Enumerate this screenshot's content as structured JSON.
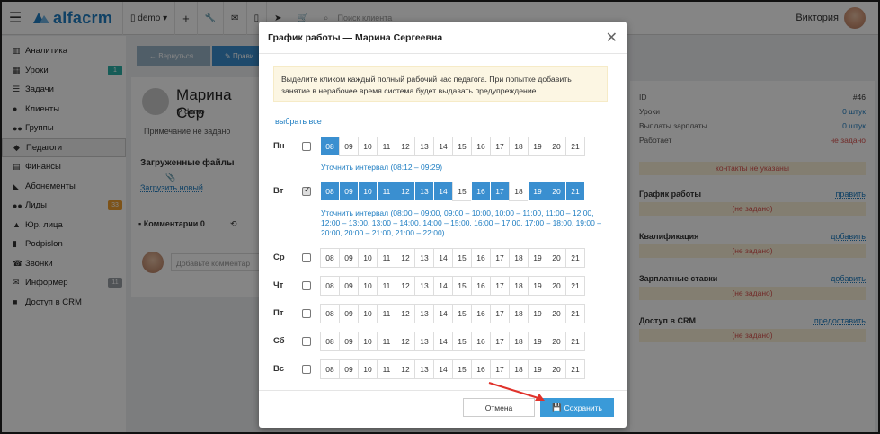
{
  "topbar": {
    "brand": "alfacrm",
    "branch": "demo",
    "search_placeholder": "Поиск клиента",
    "user_name": "Виктория"
  },
  "sidebar": {
    "items": [
      {
        "label": "Аналитика",
        "icon": "chart-icon"
      },
      {
        "label": "Уроки",
        "icon": "calendar-icon",
        "badge": "1"
      },
      {
        "label": "Задачи",
        "icon": "tasks-icon"
      },
      {
        "label": "Клиенты",
        "icon": "user-icon"
      },
      {
        "label": "Группы",
        "icon": "group-icon"
      },
      {
        "label": "Педагоги",
        "icon": "graduation-cap-icon"
      },
      {
        "label": "Финансы",
        "icon": "money-icon"
      },
      {
        "label": "Абонементы",
        "icon": "tag-icon"
      },
      {
        "label": "Лиды",
        "icon": "users-icon",
        "badge": "33"
      },
      {
        "label": "Юр. лица",
        "icon": "bank-icon"
      },
      {
        "label": "Podpislon",
        "icon": "file-icon"
      },
      {
        "label": "Звонки",
        "icon": "phone-icon"
      },
      {
        "label": "Информер",
        "icon": "envelope-icon",
        "badge": "11"
      },
      {
        "label": "Доступ в CRM",
        "icon": "lock-icon"
      }
    ]
  },
  "background": {
    "back_button": "Вернуться",
    "edit_button": "Прави",
    "teacher_name": "Марина Сер",
    "branch": "demo",
    "note": "Примечание не задано",
    "files_title": "Загруженные файлы",
    "upload_link": "Загрузить новый",
    "comments_tab": "Комментарии 0",
    "comment_placeholder": "Добавьте комментар",
    "right_panel": {
      "id_label": "ID",
      "id_value": "#46",
      "lessons_label": "Уроки",
      "lessons_value": "0 штук",
      "salary_label": "Выплаты зарплаты",
      "salary_value": "0 штук",
      "works_label": "Работает",
      "works_value": "не задано",
      "contacts_band": "контакты не указаны",
      "schedule_label": "График работы",
      "schedule_action": "править",
      "schedule_value": "(не задано)",
      "qual_label": "Квалификация",
      "qual_action": "добавить",
      "qual_value": "(не задано)",
      "rates_label": "Зарплатные ставки",
      "rates_action": "добавить",
      "rates_value": "(не задано)",
      "access_label": "Доступ в CRM",
      "access_action": "предоставить",
      "access_value": "(не задано)"
    }
  },
  "modal": {
    "title": "График работы — Марина Сергеевна",
    "notice": "Выделите кликом каждый полный рабочий час педагога. При попытке добавить занятие в нерабочее время система будет выдавать предупреждение.",
    "select_all": "выбрать все",
    "hours": [
      "08",
      "09",
      "10",
      "11",
      "12",
      "13",
      "14",
      "15",
      "16",
      "17",
      "18",
      "19",
      "20",
      "21"
    ],
    "days": [
      {
        "label": "Пн",
        "checked": false,
        "selected": [
          "08"
        ],
        "interval": "Уточнить интервал (08:12 – 09:29)"
      },
      {
        "label": "Вт",
        "checked": true,
        "selected": [
          "08",
          "09",
          "10",
          "11",
          "12",
          "13",
          "14",
          "16",
          "17",
          "19",
          "20",
          "21"
        ],
        "interval": "Уточнить интервал (08:00 – 09:00, 09:00 – 10:00, 10:00 – 11:00, 11:00 – 12:00, 12:00 – 13:00, 13:00 – 14:00, 14:00 – 15:00, 16:00 – 17:00, 17:00 – 18:00, 19:00 – 20:00, 20:00 – 21:00, 21:00 – 22:00)"
      },
      {
        "label": "Ср",
        "checked": false,
        "selected": [],
        "interval": ""
      },
      {
        "label": "Чт",
        "checked": false,
        "selected": [],
        "interval": ""
      },
      {
        "label": "Пт",
        "checked": false,
        "selected": [],
        "interval": ""
      },
      {
        "label": "Сб",
        "checked": false,
        "selected": [],
        "interval": ""
      },
      {
        "label": "Вс",
        "checked": false,
        "selected": [],
        "interval": ""
      }
    ],
    "cancel": "Отмена",
    "save": "Сохранить"
  },
  "colors": {
    "accent": "#3a8fd0",
    "brand": "#1f7ec2",
    "annotation_arrow": "#e0322b"
  }
}
